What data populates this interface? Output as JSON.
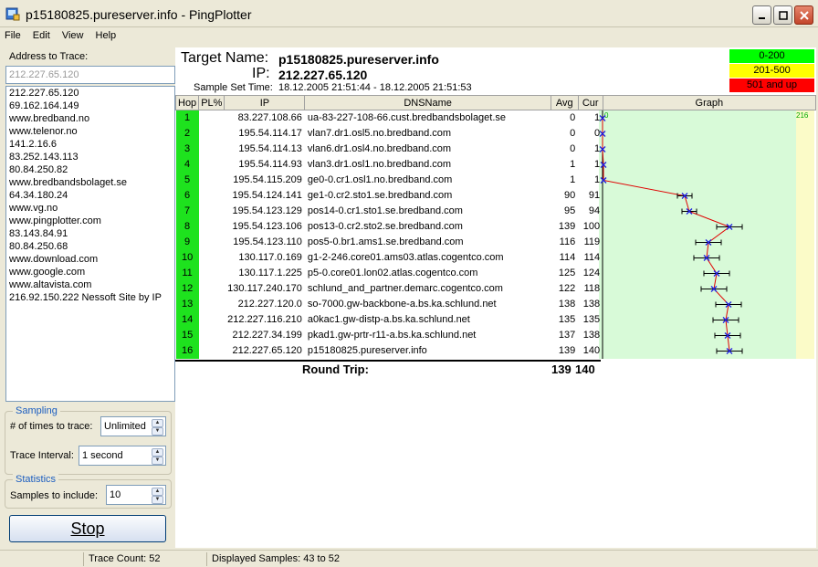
{
  "window": {
    "title": "p15180825.pureserver.info - PingPlotter"
  },
  "menu": [
    "File",
    "Edit",
    "View",
    "Help"
  ],
  "left": {
    "address_label": "Address to Trace:",
    "address_placeholder": "212.227.65.120",
    "history": [
      "212.227.65.120",
      "69.162.164.149",
      "www.bredband.no",
      "www.telenor.no",
      "141.2.16.6",
      "83.252.143.113",
      "80.84.250.82",
      "www.bredbandsbolaget.se",
      "64.34.180.24",
      "www.vg.no",
      "www.pingplotter.com",
      "83.143.84.91",
      "80.84.250.68",
      "www.download.com",
      "www.google.com",
      "www.altavista.com",
      "216.92.150.222 Nessoft Site by IP"
    ],
    "sampling": {
      "title": "Sampling",
      "times_label": "# of times to trace:",
      "times_value": "Unlimited",
      "interval_label": "Trace Interval:",
      "interval_value": "1 second"
    },
    "statistics": {
      "title": "Statistics",
      "samples_label": "Samples to include:",
      "samples_value": "10"
    },
    "stop_label": "Stop"
  },
  "header": {
    "target_label": "Target Name:",
    "target_value": "p15180825.pureserver.info",
    "ip_label": "IP:",
    "ip_value": "212.227.65.120",
    "sample_label": "Sample Set Time:",
    "sample_value": "18.12.2005 21:51:44 - 18.12.2005 21:51:53"
  },
  "legend": [
    {
      "label": "0-200",
      "color": "#00ff00"
    },
    {
      "label": "201-500",
      "color": "#ffff00"
    },
    {
      "label": "501 and up",
      "color": "#ff0000"
    }
  ],
  "columns": [
    "Hop",
    "PL%",
    "IP",
    "DNSName",
    "Avg",
    "Cur",
    "Graph"
  ],
  "graph": {
    "min_label": "0",
    "max_label": "216"
  },
  "hops": [
    {
      "hop": "1",
      "pl": "",
      "ip": "83.227.108.66",
      "dns": "ua-83-227-108-66.cust.bredbandsbolaget.se",
      "avg": "0",
      "cur": "1"
    },
    {
      "hop": "2",
      "pl": "",
      "ip": "195.54.114.17",
      "dns": "vlan7.dr1.osl5.no.bredband.com",
      "avg": "0",
      "cur": "0"
    },
    {
      "hop": "3",
      "pl": "",
      "ip": "195.54.114.13",
      "dns": "vlan6.dr1.osl4.no.bredband.com",
      "avg": "0",
      "cur": "1"
    },
    {
      "hop": "4",
      "pl": "",
      "ip": "195.54.114.93",
      "dns": "vlan3.dr1.osl1.no.bredband.com",
      "avg": "1",
      "cur": "1"
    },
    {
      "hop": "5",
      "pl": "",
      "ip": "195.54.115.209",
      "dns": "ge0-0.cr1.osl1.no.bredband.com",
      "avg": "1",
      "cur": "1"
    },
    {
      "hop": "6",
      "pl": "",
      "ip": "195.54.124.141",
      "dns": "ge1-0.cr2.sto1.se.bredband.com",
      "avg": "90",
      "cur": "91"
    },
    {
      "hop": "7",
      "pl": "",
      "ip": "195.54.123.129",
      "dns": "pos14-0.cr1.sto1.se.bredband.com",
      "avg": "95",
      "cur": "94"
    },
    {
      "hop": "8",
      "pl": "",
      "ip": "195.54.123.106",
      "dns": "pos13-0.cr2.sto2.se.bredband.com",
      "avg": "139",
      "cur": "100"
    },
    {
      "hop": "9",
      "pl": "",
      "ip": "195.54.123.110",
      "dns": "pos5-0.br1.ams1.se.bredband.com",
      "avg": "116",
      "cur": "119"
    },
    {
      "hop": "10",
      "pl": "",
      "ip": "130.117.0.169",
      "dns": "g1-2-246.core01.ams03.atlas.cogentco.com",
      "avg": "114",
      "cur": "114"
    },
    {
      "hop": "11",
      "pl": "",
      "ip": "130.117.1.225",
      "dns": "p5-0.core01.lon02.atlas.cogentco.com",
      "avg": "125",
      "cur": "124"
    },
    {
      "hop": "12",
      "pl": "",
      "ip": "130.117.240.170",
      "dns": "schlund_and_partner.demarc.cogentco.com",
      "avg": "122",
      "cur": "118"
    },
    {
      "hop": "13",
      "pl": "",
      "ip": "212.227.120.0",
      "dns": "so-7000.gw-backbone-a.bs.ka.schlund.net",
      "avg": "138",
      "cur": "138"
    },
    {
      "hop": "14",
      "pl": "",
      "ip": "212.227.116.210",
      "dns": "a0kac1.gw-distp-a.bs.ka.schlund.net",
      "avg": "135",
      "cur": "135"
    },
    {
      "hop": "15",
      "pl": "",
      "ip": "212.227.34.199",
      "dns": "pkad1.gw-prtr-r11-a.bs.ka.schlund.net",
      "avg": "137",
      "cur": "138"
    },
    {
      "hop": "16",
      "pl": "",
      "ip": "212.227.65.120",
      "dns": "p15180825.pureserver.info",
      "avg": "139",
      "cur": "140"
    }
  ],
  "roundtrip": {
    "label": "Round Trip:",
    "avg": "139",
    "cur": "140"
  },
  "status": {
    "trace_count": "Trace Count: 52",
    "displayed": "Displayed Samples: 43 to 52"
  }
}
